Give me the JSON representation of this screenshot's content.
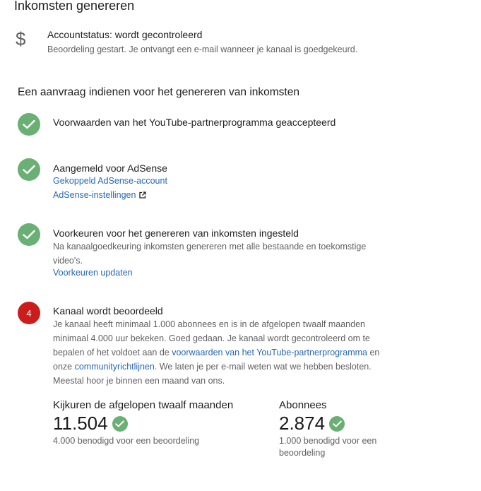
{
  "page": {
    "title": "Inkomsten genereren"
  },
  "account": {
    "icon": "dollar-icon",
    "status": "Accountstatus: wordt gecontroleerd",
    "description": "Beoordeling gestart. Je ontvangt een e-mail wanneer je kanaal is goedgekeurd."
  },
  "application": {
    "title": "Een aanvraag indienen voor het genereren van inkomsten"
  },
  "steps": [
    {
      "status": "done",
      "title": "Voorwaarden van het YouTube-partnerprogramma geaccepteerd"
    },
    {
      "status": "done",
      "title": "Aangemeld voor AdSense",
      "link1": "Gekoppeld AdSense-account",
      "link2": "AdSense-instellingen"
    },
    {
      "status": "done",
      "title": "Voorkeuren voor het genereren van inkomsten ingesteld",
      "description": "Na kanaalgoedkeuring inkomsten genereren met alle bestaande en toekomstige video's.",
      "link": "Voorkeuren updaten"
    },
    {
      "status": "in-review",
      "number": "4",
      "title": "Kanaal wordt beoordeeld",
      "desc_part1": "Je kanaal heeft minimaal 1.000 abonnees en is in de afgelopen twaalf maanden minimaal 4.000 uur bekeken. Goed gedaan. Je kanaal wordt gecontroleerd om te bepalen of het voldoet aan de ",
      "desc_link1": "voorwaarden van het YouTube-partnerprogramma",
      "desc_part2": " en onze ",
      "desc_link2": "communityrichtlijnen",
      "desc_part3": ". We laten je per e-mail weten wat we hebben besloten. Meestal hoor je binnen een maand van ons."
    }
  ],
  "stats": {
    "watch_hours": {
      "label": "Kijkuren de afgelopen twaalf maanden",
      "value": "11.504",
      "note": "4.000 benodigd voor een beoordeling"
    },
    "subscribers": {
      "label": "Abonnees",
      "value": "2.874",
      "note": "1.000 benodigd voor een beoordeling"
    }
  },
  "colors": {
    "check_green": "#6aaf74",
    "badge_red": "#cc1d1d",
    "link_blue": "#2768b5"
  }
}
